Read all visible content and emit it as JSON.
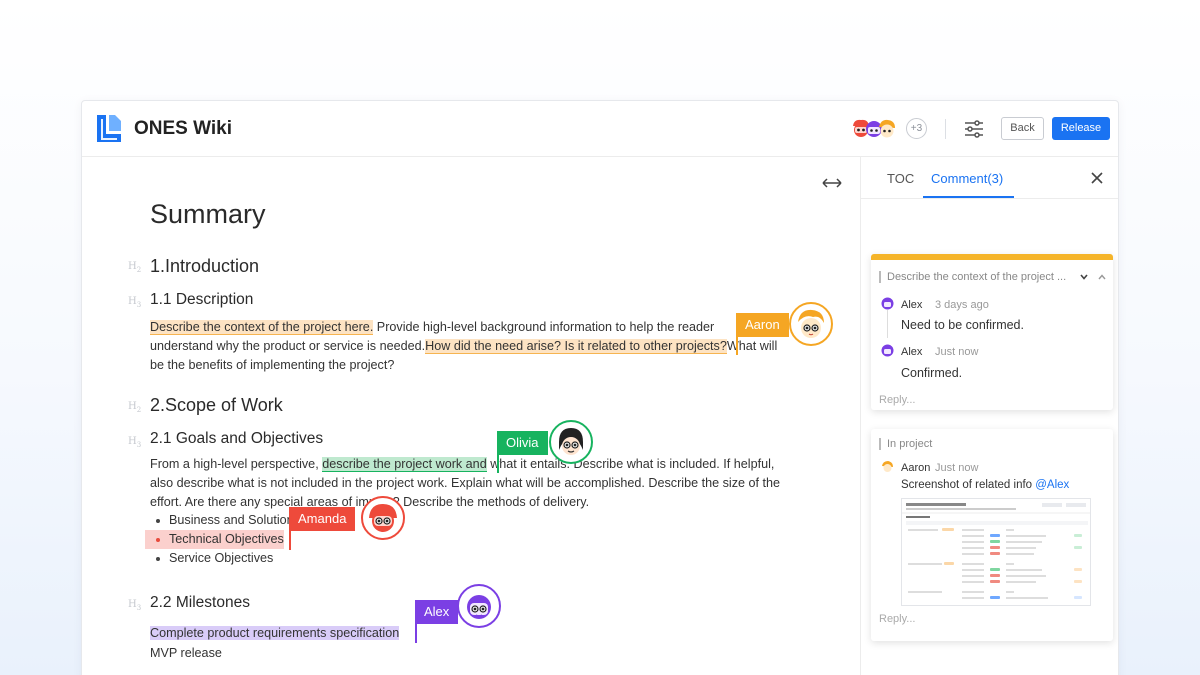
{
  "app": {
    "title": "ONES Wiki"
  },
  "header": {
    "collaborators_more": "+3",
    "back_label": "Back",
    "release_label": "Release"
  },
  "doc": {
    "title": "Summary",
    "heading_tag": "H",
    "s1": {
      "heading": "1.Introduction",
      "sub": "1.1 Description",
      "line1_hl": "Describe the context of the project here.",
      "line1_rest": " Provide high-level background information to help the reader",
      "line2_pre": "understand why the product or service is needed.",
      "line2_hl": "How did the need arise? Is it related to other projects?",
      "line2_post": "What will",
      "line3": "be the benefits of implementing the project?"
    },
    "s2": {
      "heading": "2.Scope of Work",
      "sub": "2.1 Goals and Objectives",
      "line1_pre": "From a high-level perspective, ",
      "line1_hl": "describe the project work and",
      "line1_post": " what it entails. Describe what is included. If helpful,",
      "line2": "also describe what is not included in the project work. Explain what will be accomplished. Describe the size of the",
      "line3": "effort. Are there any special areas of impact? Describe the methods of delivery.",
      "bullets": [
        "Business and Solution",
        "Technical Objectives",
        "Service Objectives"
      ]
    },
    "s3": {
      "sub": "2.2 Milestones",
      "line1_hl": "Complete product requirements specification",
      "line2": "MVP release"
    }
  },
  "cursors": {
    "aaron": {
      "name": "Aaron",
      "color": "#f5a623"
    },
    "olivia": {
      "name": "Olivia",
      "color": "#17b35f"
    },
    "amanda": {
      "name": "Amanda",
      "color": "#ee4a3b"
    },
    "alex": {
      "name": "Alex",
      "color": "#7b3fe4"
    }
  },
  "sidebar": {
    "tabs": [
      "TOC",
      "Comment(3)"
    ],
    "active_tab": "Comment(3)",
    "thread1": {
      "quote": "Describe the context of the project ...",
      "comments": [
        {
          "author": "Alex",
          "time": "3 days ago",
          "text": "Need to be confirmed."
        },
        {
          "author": "Alex",
          "time": "Just now",
          "text": "Confirmed."
        }
      ],
      "reply_placeholder": "Reply..."
    },
    "thread2": {
      "quote": "In project",
      "comments": [
        {
          "author": "Aaron",
          "time": "Just now",
          "text_pre": "Screenshot of related info ",
          "mention": "@Alex"
        }
      ],
      "reply_placeholder": "Reply..."
    }
  },
  "colors": {
    "accent": "#1a73f2",
    "comment_bar": "#f5b429"
  }
}
